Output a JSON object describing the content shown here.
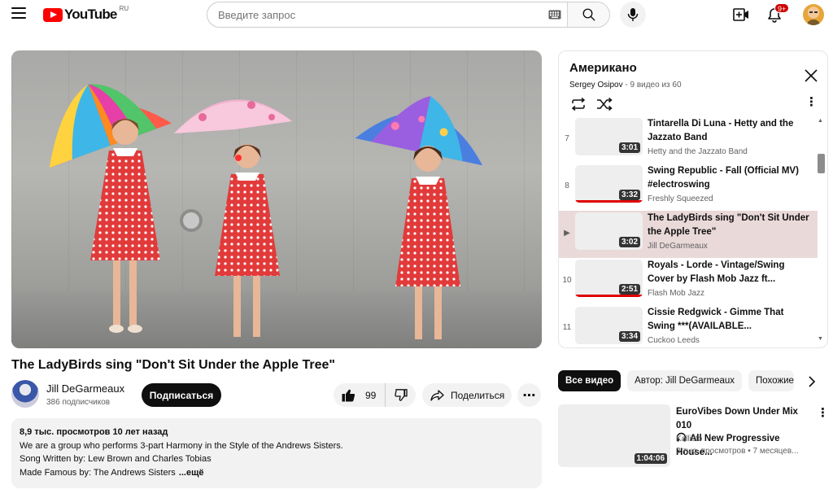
{
  "header": {
    "logo_text": "YouTube",
    "region": "RU",
    "search_placeholder": "Введите запрос",
    "notifications_badge": "9+"
  },
  "video": {
    "title": "The LadyBirds sing \"Don't Sit Under the Apple Tree\"",
    "channel_name": "Jill DeGarmeaux",
    "subscribers": "386 подписчиков",
    "subscribe_label": "Подписаться",
    "likes": "99",
    "share_label": "Поделиться",
    "more_label": "⋯"
  },
  "description": {
    "stats": "8,9 тыс. просмотров  10 лет назад",
    "lines": [
      "We are a group who performs 3-part Harmony in the Style of the Andrews Sisters.",
      "Song Written by: Lew Brown and Charles Tobias",
      "Made Famous by: The Andrews Sisters"
    ],
    "more": "...ещё"
  },
  "playlist": {
    "title": "Американо",
    "owner": "Sergey Osipov",
    "count": " - 9 видео из 60",
    "items": [
      {
        "index": "7",
        "title": "Tintarella Di Luna - Hetty and the Jazzato Band",
        "channel": "Hetty and the Jazzato Band",
        "duration": "3:01",
        "progress": 0,
        "active": false
      },
      {
        "index": "8",
        "title": "Swing Republic - Fall (Official MV) #electroswing",
        "channel": "Freshly Squeezed",
        "duration": "3:32",
        "progress": 1.0,
        "active": false
      },
      {
        "index": "▶",
        "title": "The LadyBirds sing \"Don't Sit Under the Apple Tree\"",
        "channel": "Jill DeGarmeaux",
        "duration": "3:02",
        "progress": 0,
        "active": true
      },
      {
        "index": "10",
        "title": "Royals - Lorde - Vintage/Swing Cover by Flash Mob Jazz ft...",
        "channel": "Flash Mob Jazz",
        "duration": "2:51",
        "progress": 1.0,
        "active": false
      },
      {
        "index": "11",
        "title": "Cissie Redgwick - Gimme That Swing ***(AVAILABLE...",
        "channel": "Cuckoo Leeds",
        "duration": "3:34",
        "progress": 0,
        "active": false
      }
    ]
  },
  "chips": [
    {
      "label": "Все видео",
      "selected": true
    },
    {
      "label": "Автор: Jill DeGarmeaux",
      "selected": false
    },
    {
      "label": "Похожие",
      "selected": false
    }
  ],
  "recommended": {
    "title_line1": "EuroVibes Down Under Mix 010",
    "title_line2": "All New Progressive House...",
    "channel": "Kallisto",
    "meta": "3 тыс. просмотров  • 7 месяцев...",
    "duration": "1:04:06"
  },
  "colors": {
    "brand_red": "#ff0000",
    "active_row": "#ead9d9",
    "chip_selected": "#0f0f0f",
    "progress_red": "#e00000"
  }
}
